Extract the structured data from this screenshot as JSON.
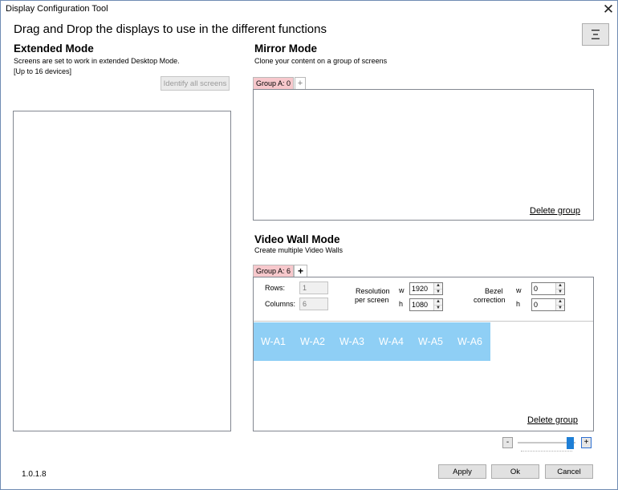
{
  "window": {
    "title": "Display Configuration Tool"
  },
  "header": {
    "instruction": "Drag and Drop the displays to use in the different functions"
  },
  "icons": {
    "close": "close-icon",
    "menu": "hamburger-menu-icon",
    "spin_up": "▲",
    "spin_down": "▼"
  },
  "extended": {
    "title": "Extended Mode",
    "subtitle_line1": "Screens are set to work in extended Desktop Mode.",
    "subtitle_line2": "[Up to 16 devices]",
    "identify_button": "Identify all screens"
  },
  "mirror": {
    "title": "Mirror Mode",
    "subtitle": "Clone your content on a group of screens",
    "tab_label": "Group A: 0",
    "add_tab": "+",
    "delete_link": "Delete group"
  },
  "videowall": {
    "title": "Video Wall Mode",
    "subtitle": "Create multiple Video Walls",
    "tab_label": "Group A: 6",
    "add_tab": "+",
    "rows_label": "Rows:",
    "rows_value": "1",
    "columns_label": "Columns:",
    "columns_value": "6",
    "resolution_label_1": "Resolution",
    "resolution_label_2": "per screen",
    "w_label": "w",
    "h_label": "h",
    "res_w": "1920",
    "res_h": "1080",
    "bezel_label_1": "Bezel",
    "bezel_label_2": "correction",
    "bezel_w": "0",
    "bezel_h": "0",
    "screens": [
      "W-A1",
      "W-A2",
      "W-A3",
      "W-A4",
      "W-A5",
      "W-A6"
    ],
    "screens_color": "#8fcff5",
    "delete_link": "Delete group"
  },
  "zoom": {
    "minus": "-",
    "plus": "+",
    "level": 0.97
  },
  "footer": {
    "version": "1.0.1.8",
    "apply": "Apply",
    "ok": "Ok",
    "cancel": "Cancel"
  },
  "colors": {
    "tab_pink": "#f7c8cc",
    "slider_thumb": "#1e7fd6",
    "window_border": "#6f8bb3"
  }
}
